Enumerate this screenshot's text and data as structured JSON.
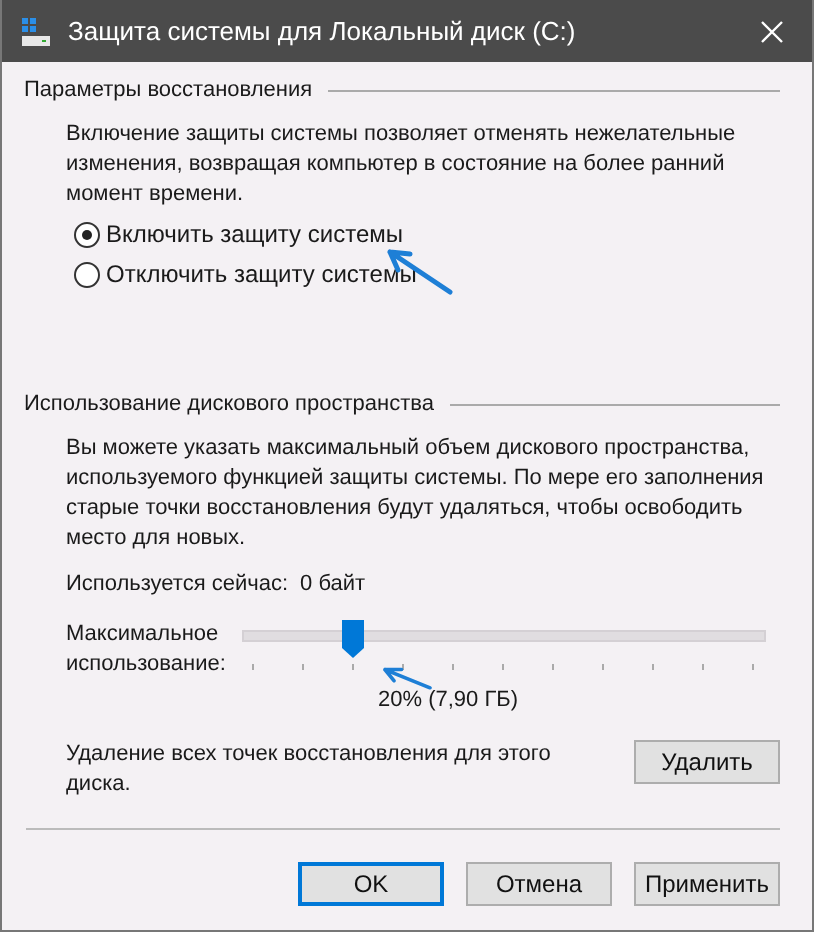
{
  "window": {
    "title": "Защита системы для Локальный диск (C:)"
  },
  "restore_settings": {
    "heading": "Параметры восстановления",
    "description": "Включение защиты системы позволяет отменять нежелательные изменения, возвращая компьютер в состояние на более ранний момент времени.",
    "options": [
      {
        "label": "Включить защиту системы",
        "selected": true
      },
      {
        "label": "Отключить защиту системы",
        "selected": false
      }
    ]
  },
  "disk_usage": {
    "heading": "Использование дискового пространства",
    "description": "Вы можете указать максимальный объем дискового пространства, используемого функцией защиты системы. По мере его заполнения старые точки восстановления будут удаляться, чтобы освободить место для новых.",
    "current_usage_label": "Используется сейчас:",
    "current_usage_value": "0 байт",
    "max_usage": {
      "label": "Максимальное использование:",
      "level": 0.2,
      "reading": "20% (7,90 ГБ)"
    },
    "delete_text": "Удаление всех точек восстановления для этого диска.",
    "delete_button": "Удалить"
  },
  "buttons": [
    {
      "label": "OK",
      "focused": true
    },
    {
      "label": "Отмена",
      "focused": false
    },
    {
      "label": "Применить",
      "focused": false
    }
  ]
}
